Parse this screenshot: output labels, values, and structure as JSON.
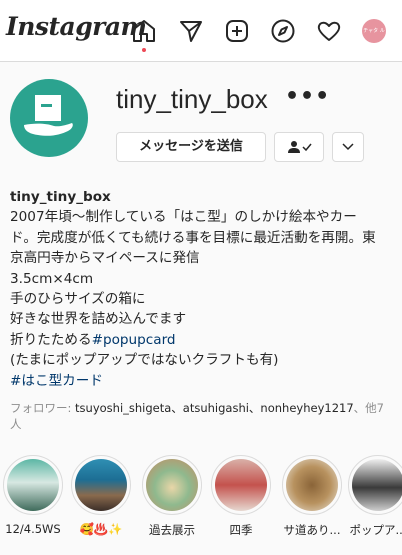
{
  "header": {
    "logo_text": "Instagram",
    "nav_icons": [
      "home-icon",
      "direct-icon",
      "new-post-icon",
      "explore-icon",
      "activity-icon",
      "profile-avatar"
    ],
    "avatar_text": "チャタ ルーム"
  },
  "profile": {
    "username": "tiny_tiny_box",
    "more_label": "•••",
    "message_button": "メッセージを送信"
  },
  "bio": {
    "name": "tiny_tiny_box",
    "lines": [
      "2007年頃〜制作している「はこ型」のしかけ絵本やカー",
      "ド。完成度が低くても続ける事を目標に最近活動を再開。東",
      "京高円寺からマイペースに発信",
      "3.5cm×4cm",
      "手のひらサイズの箱に",
      "好きな世界を詰め込んでます"
    ],
    "line7_prefix": "折りたためる",
    "line7_tag": "#popupcard",
    "line8": "(たまにポップアップではないクラフトも有)",
    "line9_tag": "#はこ型カード"
  },
  "followers": {
    "prefix": "フォロワー: ",
    "names": "tsuyoshi_shigeta、atsuhigashi、nonheyhey1217",
    "suffix": "、他7人"
  },
  "highlights": [
    {
      "label": "12/4.5WS"
    },
    {
      "label": "🥰♨️✨"
    },
    {
      "label": "過去展示"
    },
    {
      "label": "四季"
    },
    {
      "label": "サ道あり..."
    },
    {
      "label": "ポップア..."
    }
  ],
  "colors": {
    "accent_dot": "#ed4956",
    "profile_bg": "#2ba38f",
    "hashtag": "#00376b"
  }
}
